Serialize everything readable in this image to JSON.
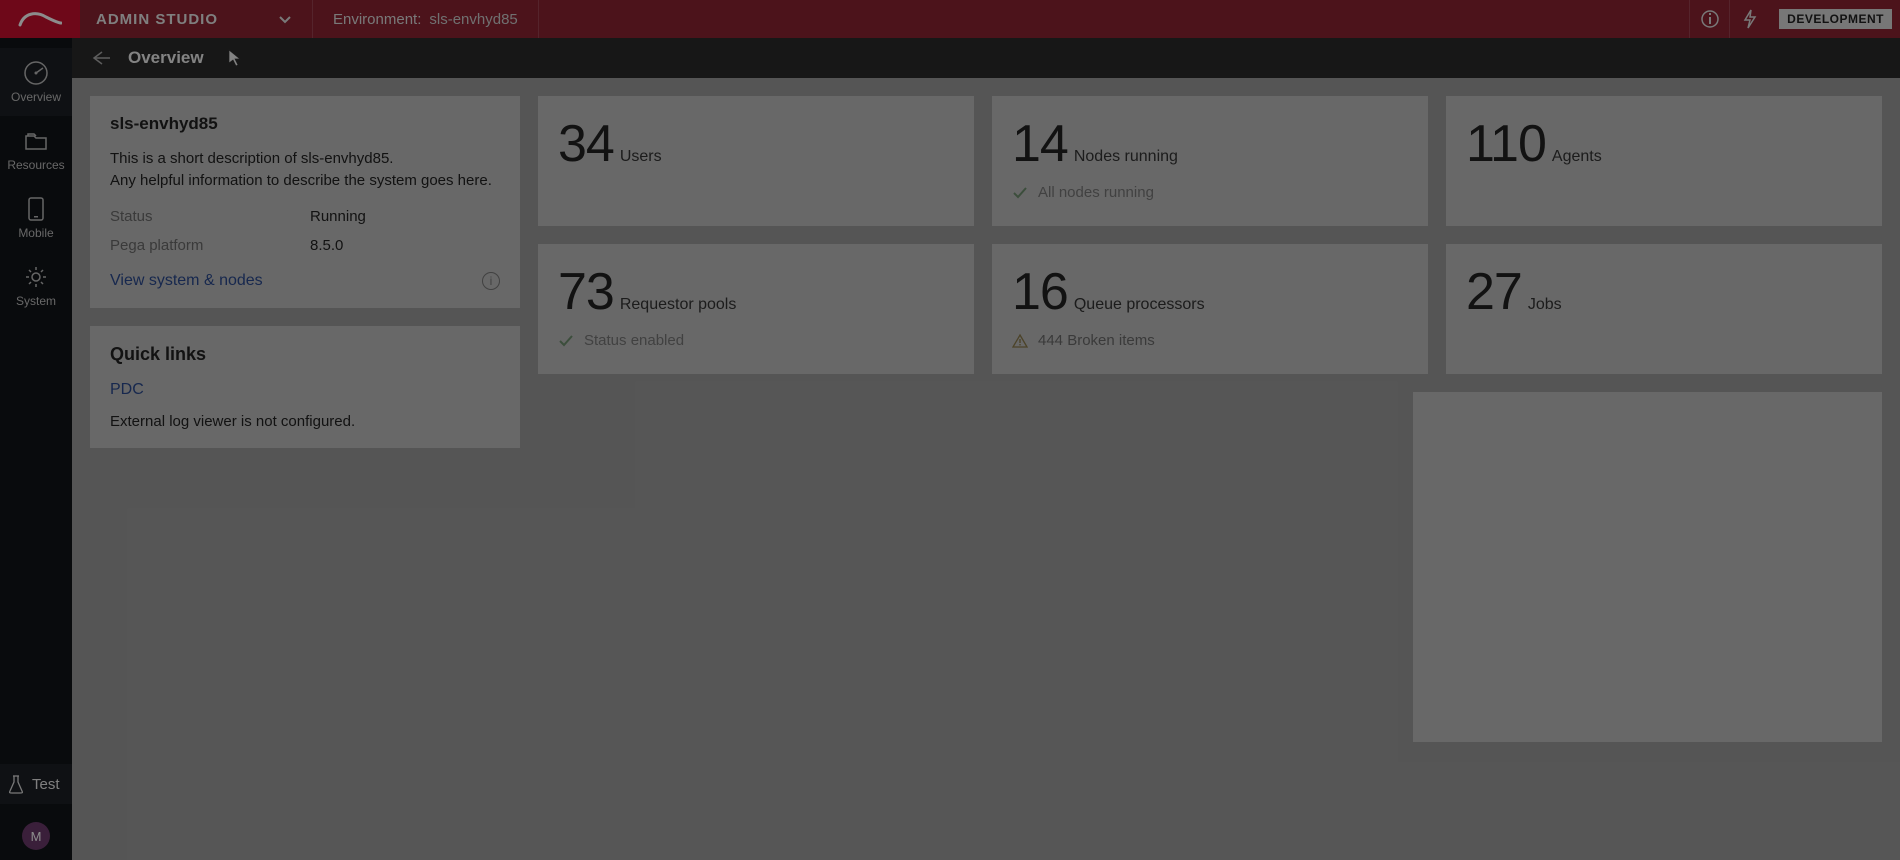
{
  "topbar": {
    "studio_name": "ADMIN STUDIO",
    "env_label": "Environment:",
    "env_name": "sls-envhyd85",
    "dev_badge": "DEVELOPMENT"
  },
  "leftnav": {
    "items": [
      {
        "label": "Overview"
      },
      {
        "label": "Resources"
      },
      {
        "label": "Mobile"
      },
      {
        "label": "System"
      }
    ],
    "test_label": "Test",
    "avatar_letter": "M"
  },
  "subheader": {
    "title": "Overview"
  },
  "info_card": {
    "title": "sls-envhyd85",
    "desc": "This is a short description of sls-envhyd85.\nAny helpful information to describe the system goes here.",
    "status_label": "Status",
    "status_value": "Running",
    "platform_label": "Pega platform",
    "platform_value": "8.5.0",
    "view_link": "View system & nodes"
  },
  "quick_links": {
    "title": "Quick links",
    "pdc": "PDC",
    "note": "External log viewer is not configured."
  },
  "stats": {
    "users": {
      "value": "34",
      "label": "Users"
    },
    "nodes": {
      "value": "14",
      "label": "Nodes running",
      "sub": "All nodes running"
    },
    "agents": {
      "value": "110",
      "label": "Agents"
    },
    "requestors": {
      "value": "73",
      "label": "Requestor pools",
      "sub": "Status enabled"
    },
    "queues": {
      "value": "16",
      "label": "Queue processors",
      "sub": "444 Broken items"
    },
    "jobs": {
      "value": "27",
      "label": "Jobs"
    }
  }
}
